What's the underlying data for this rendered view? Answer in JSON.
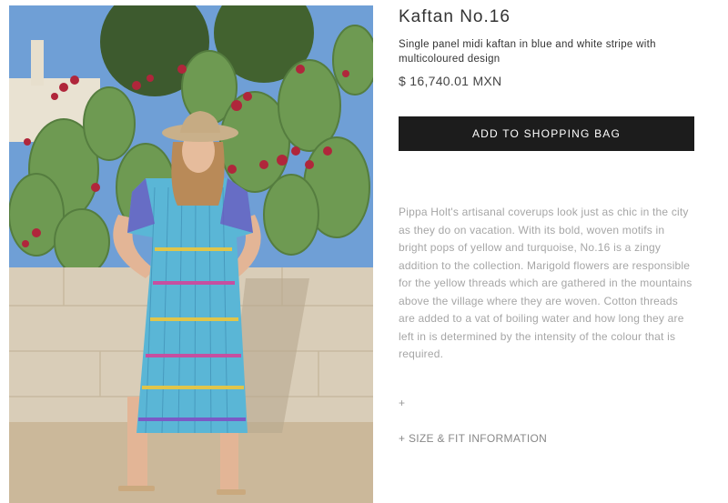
{
  "product": {
    "title": "Kaftan No.16",
    "subtitle": "Single panel midi kaftan in blue and white stripe with multicoloured design",
    "price": "$ 16,740.01 MXN",
    "add_to_bag_label": "ADD TO SHOPPING BAG",
    "description": "Pippa Holt's artisanal coverups look just as chic in the city as they do on vacation. With its bold, woven motifs in bright pops of yellow and turquoise, No.16 is a zingy addition to the collection. Marigold flowers are responsible for the yellow threads which are gathered in the mountains above the village where they are woven. Cotton threads are added to a vat of boiling water and how long they are left in is determined by the intensity of the colour that is required.",
    "expand_label": "+",
    "size_fit_label": "+ SIZE & FIT INFORMATION"
  },
  "colors": {
    "button_bg": "#1c1c1c",
    "button_text": "#ffffff",
    "description_text": "#a6a6a6",
    "dress": "#5ab6d6"
  }
}
